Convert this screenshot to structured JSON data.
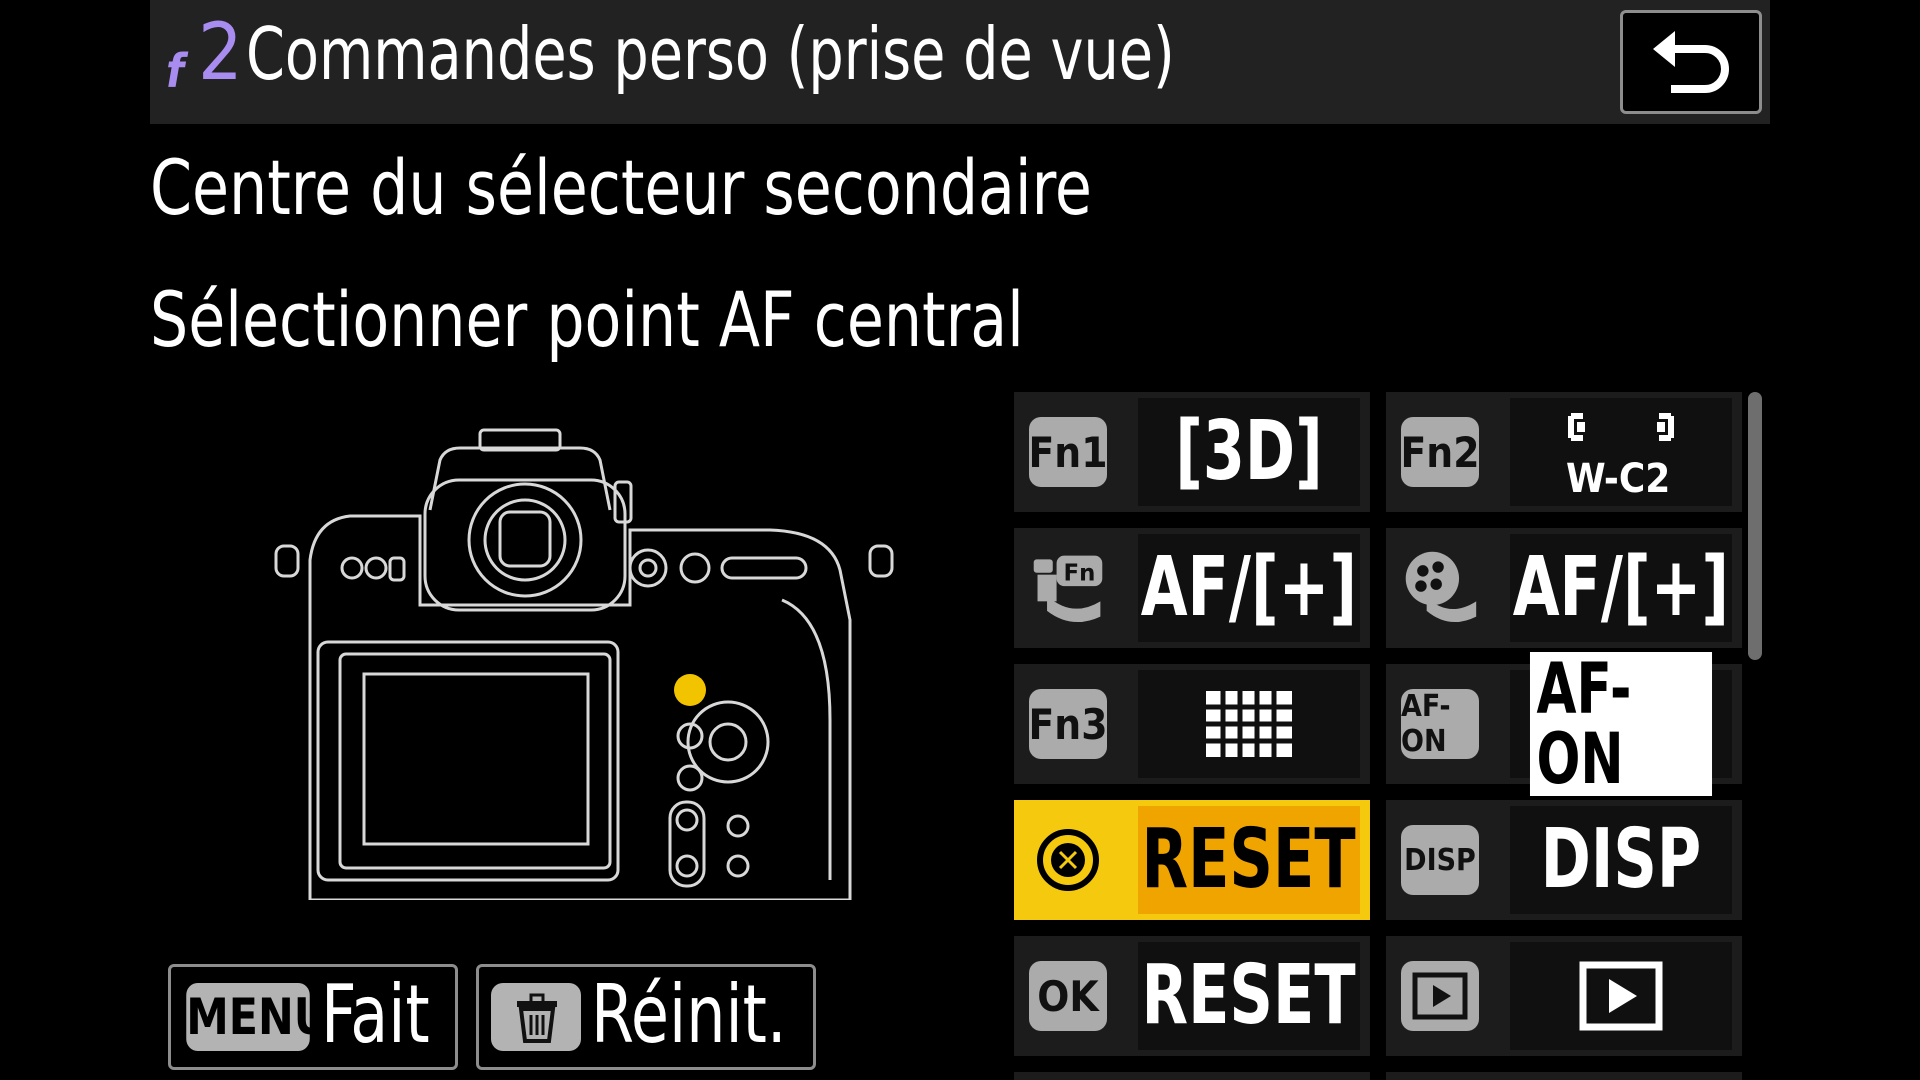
{
  "header": {
    "menu_letter": "f",
    "menu_number": "2",
    "title": "Commandes perso (prise de vue)"
  },
  "control_name": "Centre du sélecteur secondaire",
  "assigned_function": "Sélectionner point AF central",
  "footer": {
    "done_badge": "MENU",
    "done_label": "Fait",
    "reset_label": "Réinit."
  },
  "grid": [
    {
      "icon": "Fn1",
      "value": "[3D]"
    },
    {
      "icon": "Fn2",
      "value": "W-C2"
    },
    {
      "icon": "lens-fn-icon",
      "value": "AF/[+]"
    },
    {
      "icon": "lens-control-ring-icon",
      "value": "AF/[+]"
    },
    {
      "icon": "Fn3",
      "value": "grid-icon"
    },
    {
      "icon": "AF-ON",
      "value": "AF-ON"
    },
    {
      "icon": "sub-selector-center-icon",
      "value": "RESET",
      "selected": true
    },
    {
      "icon": "DISP",
      "value": "DISP"
    },
    {
      "icon": "OK",
      "value": "RESET"
    },
    {
      "icon": "playback-icon",
      "value": "playback-icon"
    }
  ],
  "colors": {
    "accent": "#a98cf0",
    "selected": "#f5c90e",
    "selected_value": "#f0a400"
  }
}
